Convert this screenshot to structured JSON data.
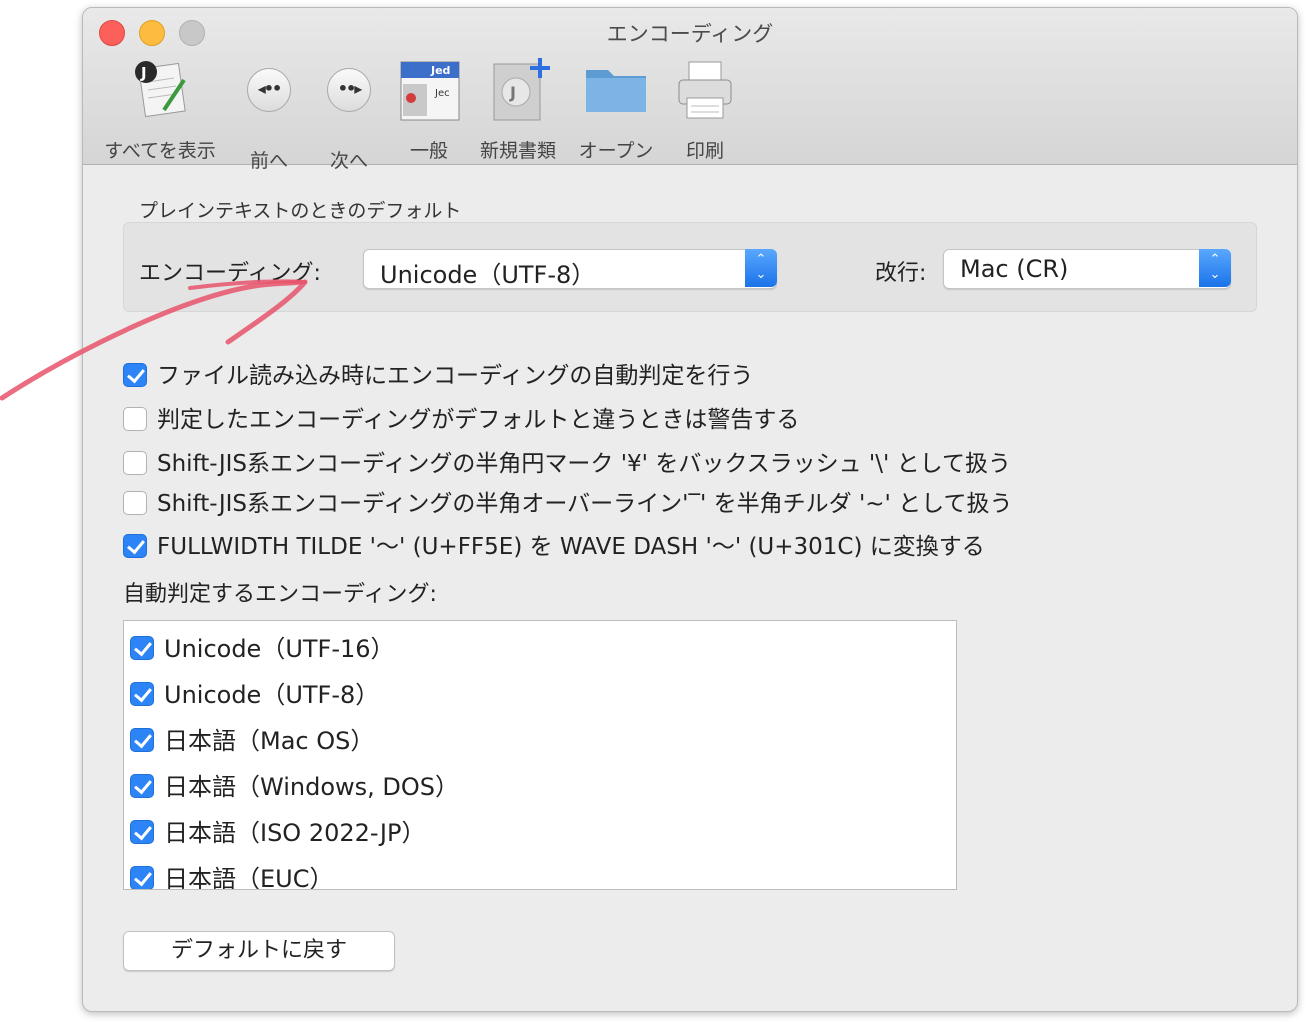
{
  "window": {
    "title": "エンコーディング"
  },
  "toolbar": [
    {
      "label": "すべてを表示",
      "icon": "jedit-show-all-icon"
    },
    {
      "label": "前へ",
      "icon": "back-icon"
    },
    {
      "label": "次へ",
      "icon": "forward-icon"
    },
    {
      "label": "一般",
      "icon": "general-icon"
    },
    {
      "label": "新規書類",
      "icon": "new-document-icon"
    },
    {
      "label": "オープン",
      "icon": "folder-icon"
    },
    {
      "label": "印刷",
      "icon": "printer-icon"
    }
  ],
  "plain_default": {
    "section_title": "プレインテキストのときのデフォルト",
    "encoding_label": "エンコーディング:",
    "encoding_value": "Unicode（UTF-8）",
    "linebreak_label": "改行:",
    "linebreak_value": "Mac (CR)"
  },
  "options": [
    {
      "label": "ファイル読み込み時にエンコーディングの自動判定を行う",
      "checked": true
    },
    {
      "label": "判定したエンコーディングがデフォルトと違うときは警告する",
      "checked": false
    },
    {
      "label": "Shift-JIS系エンコーディングの半角円マーク '¥' をバックスラッシュ '\\' として扱う",
      "checked": false
    },
    {
      "label": "Shift-JIS系エンコーディングの半角オーバーライン'‾' を半角チルダ '~' として扱う",
      "checked": false
    },
    {
      "label": "FULLWIDTH TILDE '〜' (U+FF5E) を WAVE DASH '〜' (U+301C) に変換する",
      "checked": true
    }
  ],
  "auto_detect": {
    "title": "自動判定するエンコーディング:",
    "items": [
      {
        "label": "Unicode（UTF-16）",
        "checked": true
      },
      {
        "label": "Unicode（UTF-8）",
        "checked": true
      },
      {
        "label": "日本語（Mac OS）",
        "checked": true
      },
      {
        "label": "日本語（Windows, DOS）",
        "checked": true
      },
      {
        "label": "日本語（ISO 2022-JP）",
        "checked": true
      },
      {
        "label": "日本語（EUC）",
        "checked": true
      }
    ]
  },
  "reset_button": "デフォルトに戻す",
  "colors": {
    "accent": "#2c84f6",
    "annotation": "#e8536b"
  }
}
